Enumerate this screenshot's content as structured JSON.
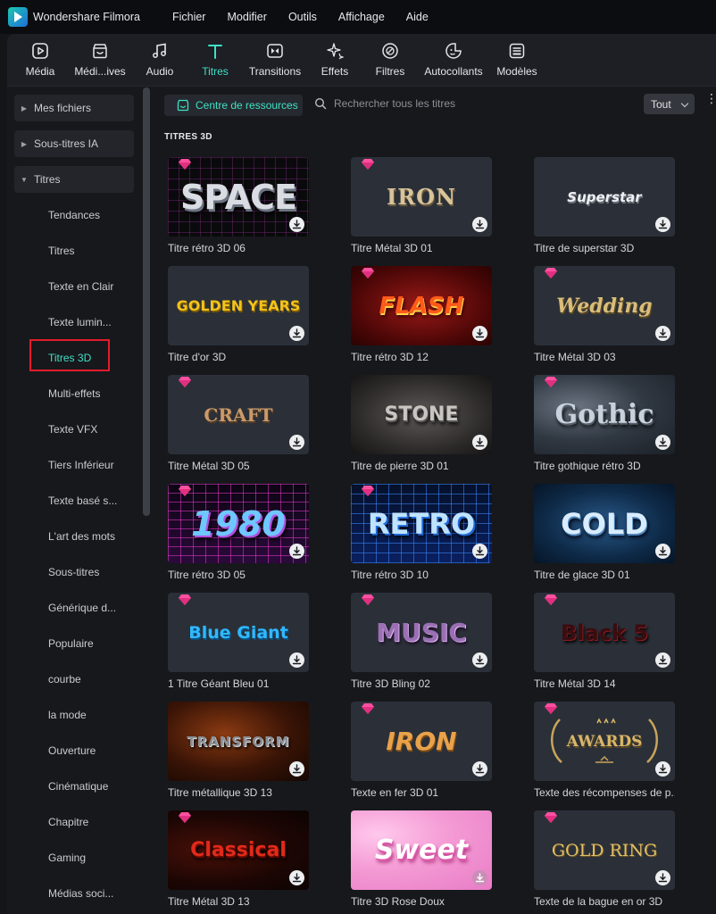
{
  "app": {
    "title": "Wondershare Filmora"
  },
  "menu": [
    "Fichier",
    "Modifier",
    "Outils",
    "Affichage",
    "Aide"
  ],
  "toolbar": [
    {
      "label": "Média",
      "icon": "media-icon"
    },
    {
      "label": "Médi...ives",
      "icon": "stock-media-icon"
    },
    {
      "label": "Audio",
      "icon": "music-note-icon"
    },
    {
      "label": "Titres",
      "icon": "title-t-icon",
      "active": true
    },
    {
      "label": "Transitions",
      "icon": "transition-icon"
    },
    {
      "label": "Effets",
      "icon": "effects-sparkle-icon"
    },
    {
      "label": "Filtres",
      "icon": "filter-icon"
    },
    {
      "label": "Autocollants",
      "icon": "sticker-icon"
    },
    {
      "label": "Modèles",
      "icon": "template-icon"
    }
  ],
  "sidebar": {
    "categories": [
      {
        "label": "Mes fichiers",
        "expanded": false
      },
      {
        "label": "Sous-titres IA",
        "expanded": false
      },
      {
        "label": "Titres",
        "expanded": true
      }
    ],
    "subitems": [
      "Tendances",
      "Titres",
      "Texte en Clair",
      "Texte lumin...",
      "Titres 3D",
      "Multi-effets",
      "Texte VFX",
      "Tiers Inférieur",
      "Texte basé s...",
      "L'art des mots",
      "Sous-titres",
      "Générique d...",
      "Populaire",
      "courbe",
      "la mode",
      "Ouverture",
      "Cinématique",
      "Chapitre",
      "Gaming",
      "Médias soci..."
    ],
    "active_subitem": "Titres 3D"
  },
  "main": {
    "resource_center_label": "Centre de ressources",
    "search_placeholder": "Rechercher tous les titres",
    "filter_value": "Tout",
    "section_title": "TITRES 3D",
    "cards": [
      {
        "name": "Titre rétro 3D 06",
        "thumb_text": "SPACE",
        "premium": true
      },
      {
        "name": "Titre Métal 3D 01",
        "thumb_text": "IRON",
        "premium": true
      },
      {
        "name": "Titre de superstar 3D",
        "thumb_text": "Superstar",
        "premium": false
      },
      {
        "name": "Titre d'or 3D",
        "thumb_text": "GOLDEN YEARS",
        "premium": false
      },
      {
        "name": "Titre rétro 3D 12",
        "thumb_text": "FLASH",
        "premium": true
      },
      {
        "name": "Titre Métal 3D 03",
        "thumb_text": "Wedding",
        "premium": true
      },
      {
        "name": "Titre Métal 3D 05",
        "thumb_text": "CRAFT",
        "premium": true
      },
      {
        "name": "Titre de pierre 3D 01",
        "thumb_text": "STONE",
        "premium": false
      },
      {
        "name": "Titre gothique rétro 3D",
        "thumb_text": "Gothic",
        "premium": true
      },
      {
        "name": "Titre rétro 3D 05",
        "thumb_text": "1980",
        "premium": true
      },
      {
        "name": "Titre rétro 3D 10",
        "thumb_text": "RETRO",
        "premium": true
      },
      {
        "name": "Titre de glace 3D 01",
        "thumb_text": "COLD",
        "premium": false
      },
      {
        "name": "1 Titre Géant Bleu 01",
        "thumb_text": "Blue Giant",
        "premium": true
      },
      {
        "name": "Titre 3D Bling 02",
        "thumb_text": "MUSIC",
        "premium": true
      },
      {
        "name": "Titre Métal 3D 14",
        "thumb_text": "Black 5",
        "premium": true
      },
      {
        "name": "Titre métallique 3D 13",
        "thumb_text": "TRANSFORM",
        "premium": false
      },
      {
        "name": "Texte en fer 3D 01",
        "thumb_text": "IRON",
        "premium": true
      },
      {
        "name": "Texte des récompenses de p...",
        "thumb_text": "AWARDS",
        "premium": true
      },
      {
        "name": "Titre Métal 3D 13",
        "thumb_text": "Classical",
        "premium": true
      },
      {
        "name": "Titre 3D Rose Doux",
        "thumb_text": "Sweet",
        "premium": false
      },
      {
        "name": "Texte de la bague en or 3D",
        "thumb_text": "GOLD RING",
        "premium": true
      }
    ]
  }
}
